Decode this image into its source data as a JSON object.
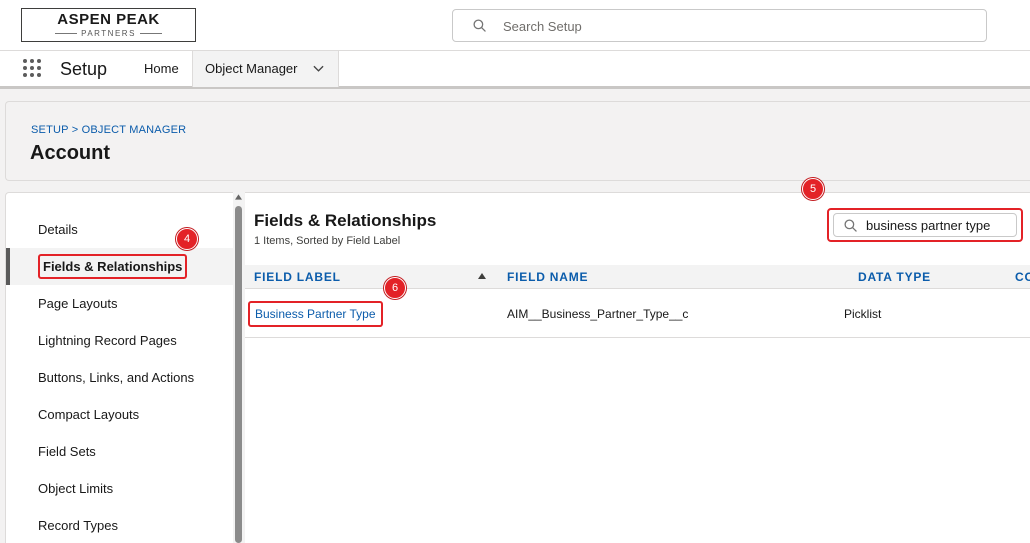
{
  "header": {
    "logo": {
      "name": "ASPEN PEAK",
      "sub": "PARTNERS"
    },
    "search": {
      "placeholder": "Search Setup",
      "value": ""
    }
  },
  "nav": {
    "app_name": "Setup",
    "tabs": [
      {
        "label": "Home",
        "active": false
      },
      {
        "label": "Object Manager",
        "active": true
      }
    ]
  },
  "page": {
    "breadcrumb": "SETUP > OBJECT MANAGER",
    "title": "Account"
  },
  "sidebar": {
    "items": [
      {
        "label": "Details",
        "active": false
      },
      {
        "label": "Fields & Relationships",
        "active": true
      },
      {
        "label": "Page Layouts",
        "active": false
      },
      {
        "label": "Lightning Record Pages",
        "active": false
      },
      {
        "label": "Buttons, Links, and Actions",
        "active": false
      },
      {
        "label": "Compact Layouts",
        "active": false
      },
      {
        "label": "Field Sets",
        "active": false
      },
      {
        "label": "Object Limits",
        "active": false
      },
      {
        "label": "Record Types",
        "active": false
      }
    ]
  },
  "main": {
    "title": "Fields & Relationships",
    "subtitle": "1 Items, Sorted by Field Label",
    "quick_find": {
      "value": "business partner type",
      "placeholder": ""
    },
    "table": {
      "columns": [
        "FIELD LABEL",
        "FIELD NAME",
        "DATA TYPE",
        "CO"
      ],
      "rows": [
        {
          "field_label": "Business Partner Type",
          "field_name": "AIM__Business_Partner_Type__c",
          "data_type": "Picklist"
        }
      ]
    }
  },
  "markers": [
    "4",
    "5",
    "6"
  ],
  "colors": {
    "link": "#0b5cab",
    "highlight": "#e32227",
    "page_bg": "#f3f2f2",
    "active_item_bar": "#5a5a5a"
  }
}
